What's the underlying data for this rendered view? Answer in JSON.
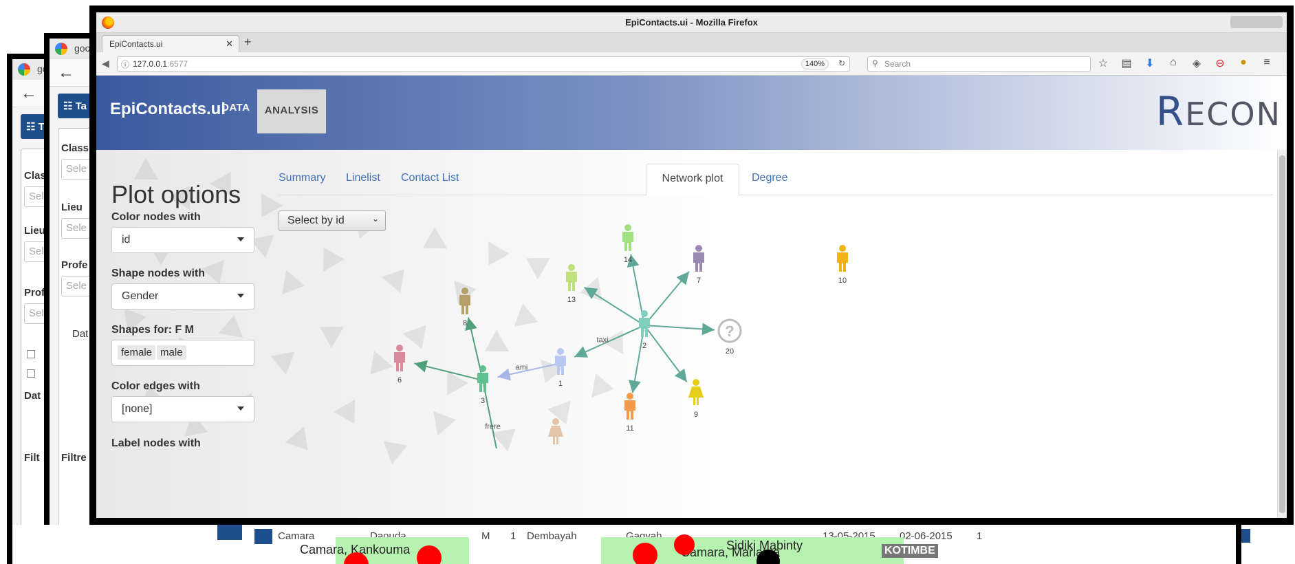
{
  "background_windows": {
    "tab_label": "goo",
    "table_button": "Ta",
    "labels": [
      "Class",
      "Lieu",
      "Profe",
      "Dat",
      "Filtre",
      "Filt"
    ],
    "select_placeholder": "Sele"
  },
  "browser": {
    "window_title": "EpiContacts.ui - Mozilla Firefox",
    "tab_title": "EpiContacts.ui",
    "url_host": "127.0.0.1",
    "url_port": ":6577",
    "zoom": "140%",
    "search_placeholder": "Search"
  },
  "navbar": {
    "brand": "EpiContacts.ui",
    "items": [
      "DATA",
      "ANALYSIS"
    ],
    "active": "ANALYSIS",
    "logo_first": "R",
    "logo_rest": "ECON"
  },
  "sidebar": {
    "title": "Plot options",
    "color_nodes_label": "Color nodes with",
    "color_nodes_value": "id",
    "shape_nodes_label": "Shape nodes with",
    "shape_nodes_value": "Gender",
    "shapes_for_label": "Shapes for: F M",
    "shapes_for_tags": [
      "female",
      "male"
    ],
    "color_edges_label": "Color edges with",
    "color_edges_value": "[none]",
    "label_nodes_label": "Label nodes with"
  },
  "tabs": {
    "items": [
      "Summary",
      "Linelist",
      "Contact List",
      "Network plot",
      "Degree"
    ],
    "active": "Network plot"
  },
  "network": {
    "select_placeholder": "Select by id",
    "nodes": [
      {
        "id": "1",
        "shape": "male",
        "color": "#b8c8f0"
      },
      {
        "id": "2",
        "shape": "male",
        "color": "#7fcfbf"
      },
      {
        "id": "3",
        "shape": "male",
        "color": "#5fbf8f"
      },
      {
        "id": "6",
        "shape": "male",
        "color": "#d98b99"
      },
      {
        "id": "7",
        "shape": "male",
        "color": "#9a8ab2"
      },
      {
        "id": "8",
        "shape": "male",
        "color": "#b5a06a"
      },
      {
        "id": "9",
        "shape": "female",
        "color": "#e6cf1a"
      },
      {
        "id": "10",
        "shape": "male",
        "color": "#f2b316"
      },
      {
        "id": "11",
        "shape": "male",
        "color": "#f29a4a"
      },
      {
        "id": "13",
        "shape": "male",
        "color": "#bfe07a"
      },
      {
        "id": "14",
        "shape": "male",
        "color": "#9fe07f"
      },
      {
        "id": "20",
        "shape": "unknown",
        "color": "#bdbdbd"
      }
    ],
    "edges": [
      {
        "from": "1",
        "to": "3",
        "label": "ami"
      },
      {
        "from": "2",
        "to": "1",
        "label": "taxi"
      },
      {
        "from": "3",
        "to": "6",
        "label": ""
      },
      {
        "from": "3",
        "to": "8",
        "label": ""
      },
      {
        "from": "3",
        "to": "",
        "label": "frere"
      },
      {
        "from": "2",
        "to": "13",
        "label": ""
      },
      {
        "from": "2",
        "to": "14",
        "label": ""
      },
      {
        "from": "2",
        "to": "7",
        "label": ""
      },
      {
        "from": "2",
        "to": "20",
        "label": ""
      },
      {
        "from": "2",
        "to": "9",
        "label": ""
      },
      {
        "from": "2",
        "to": "11",
        "label": ""
      }
    ],
    "unknown_glyph": "?"
  },
  "bottom_strip": {
    "row_cells": [
      "Camara",
      "Daouda",
      "M",
      "1",
      "Dembayah",
      "Gagyah",
      "13-05-2015",
      "02-06-2015",
      "1"
    ],
    "labels": [
      "Camara, Kankouma",
      "Camara, Mariama",
      "Sidiki Mabinty"
    ],
    "badge": "KOTIMBE"
  }
}
